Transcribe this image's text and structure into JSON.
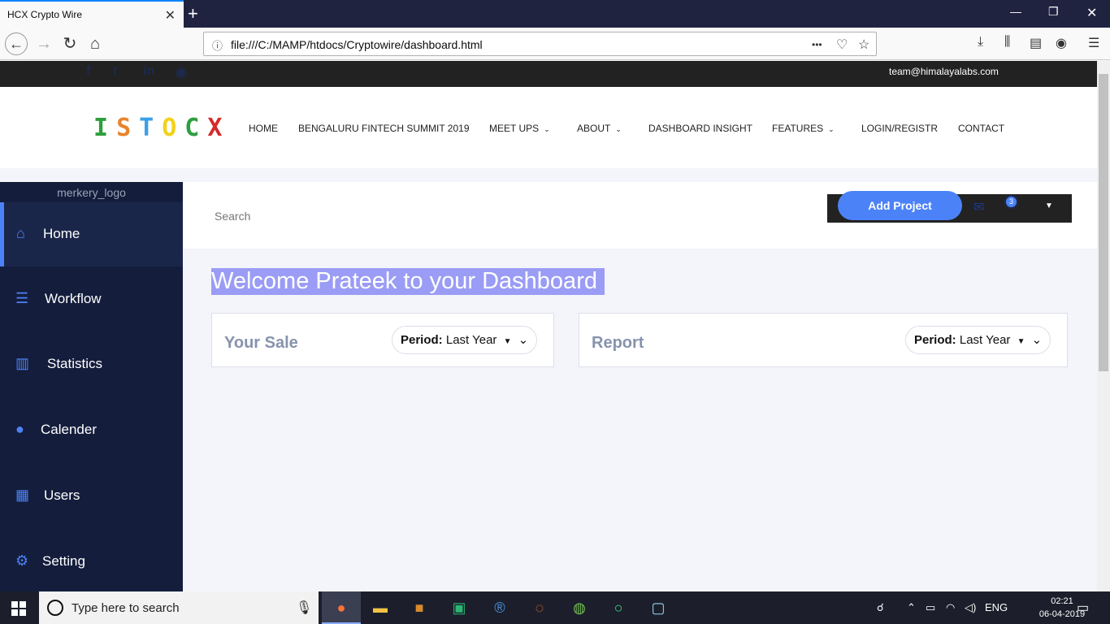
{
  "browser": {
    "tab_title": "HCX Crypto Wire",
    "url": "file:///C:/MAMP/htdocs/Cryptowire/dashboard.html",
    "new_tab_label": "+",
    "urlbar_more": "•••"
  },
  "topstrip": {
    "email": "team@himalayalabs.com",
    "social": [
      "f",
      "t",
      "in",
      "◉"
    ]
  },
  "header": {
    "logo_letters": [
      "I",
      "S",
      "T",
      "O",
      "C",
      "X"
    ],
    "logo_colors": [
      "#2e9e3e",
      "#e8842c",
      "#3aa0e8",
      "#f2d21a",
      "#2e9e3e",
      "#d42a2a"
    ],
    "menu": [
      {
        "label": "HOME",
        "chevron": false
      },
      {
        "label": "BENGALURU FINTECH SUMMIT 2019",
        "chevron": false
      },
      {
        "label": "MEET UPS",
        "chevron": true
      },
      {
        "label": "ABOUT",
        "chevron": true
      },
      {
        "label": "DASHBOARD INSIGHT",
        "chevron": false
      },
      {
        "label": "FEATURES",
        "chevron": true
      },
      {
        "label": "LOGIN/REGISTR",
        "chevron": false
      },
      {
        "label": "CONTACT",
        "chevron": false
      }
    ]
  },
  "sidebar": {
    "brand": "merkery_logo",
    "items": [
      {
        "label": "Home",
        "icon": "home-icon",
        "glyph": "⌂",
        "active": true
      },
      {
        "label": "Workflow",
        "icon": "workflow-icon",
        "glyph": "☰",
        "active": false
      },
      {
        "label": "Statistics",
        "icon": "bar-chart-icon",
        "glyph": "▥",
        "active": false
      },
      {
        "label": "Calender",
        "icon": "user-icon",
        "glyph": "●",
        "active": false
      },
      {
        "label": "Users",
        "icon": "calendar-icon",
        "glyph": "▦",
        "active": false
      },
      {
        "label": "Setting",
        "icon": "gear-icon",
        "glyph": "⚙",
        "active": false
      }
    ]
  },
  "content": {
    "search_placeholder": "Search",
    "add_project": "Add Project",
    "notification_count": "3",
    "welcome": "Welcome Prateek to your Dashboard",
    "cards": [
      {
        "title": "Your Sale",
        "period_label": "Period:",
        "period_value": "Last Year"
      },
      {
        "title": "Report",
        "period_label": "Period:",
        "period_value": "Last Year"
      }
    ]
  },
  "taskbar": {
    "search_placeholder": "Type here to search",
    "lang": "ENG",
    "time": "02:21",
    "date": "06-04-2019"
  },
  "colors": {
    "accent": "#4c82f7",
    "sidebar_bg": "#141d3c",
    "welcome_highlight": "#9a9cf5"
  }
}
